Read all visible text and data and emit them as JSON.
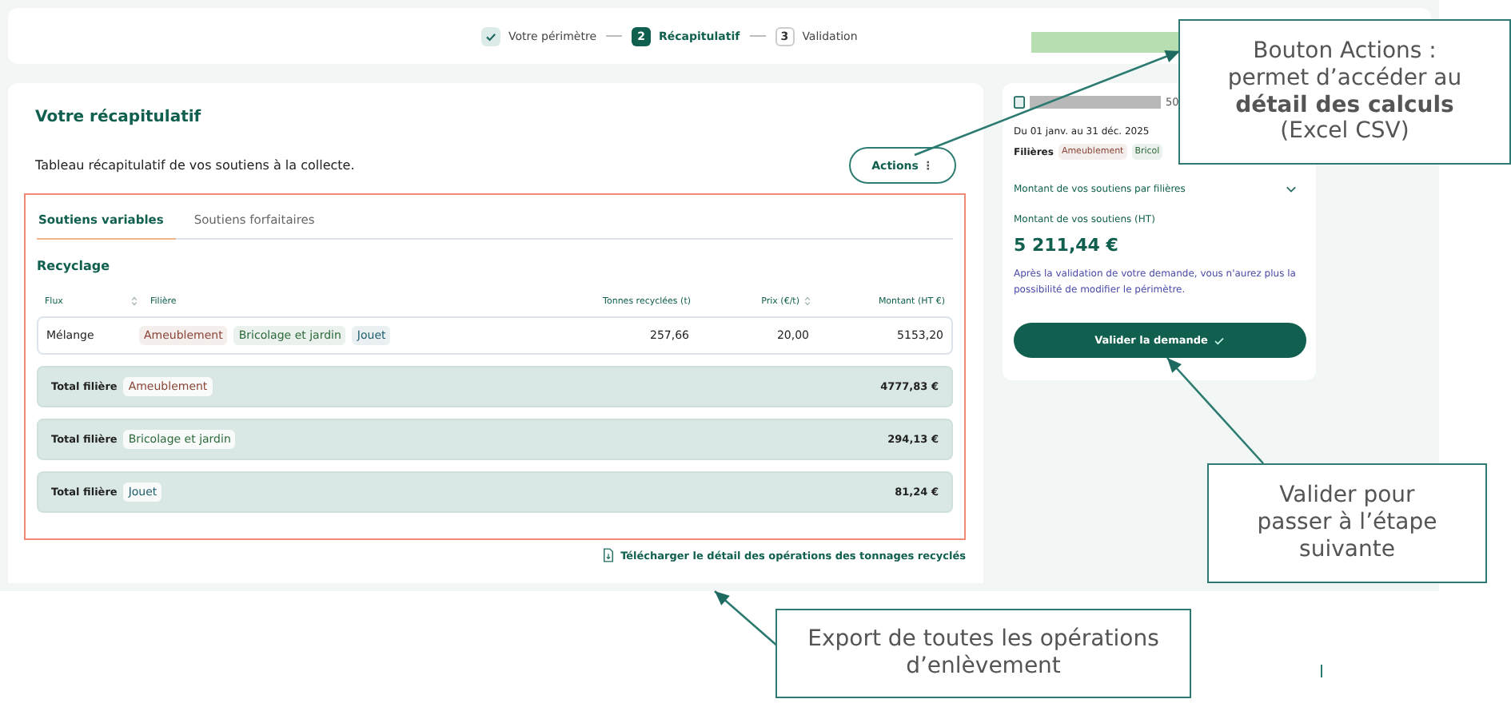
{
  "stepper": {
    "steps": [
      {
        "label": "Votre périmètre",
        "kind": "done"
      },
      {
        "number": "2",
        "label": "Récapitulatif",
        "kind": "current"
      },
      {
        "number": "3",
        "label": "Validation",
        "kind": "upcoming"
      }
    ]
  },
  "summary": {
    "title": "Votre récapitulatif",
    "description": "Tableau récapitulatif de vos soutiens à la collecte.",
    "actions_button": "Actions",
    "actions_icon": "⋮",
    "tabs": [
      {
        "label": "Soutiens variables",
        "selected": true
      },
      {
        "label": "Soutiens forfaitaires",
        "selected": false
      }
    ],
    "section_title": "Recyclage",
    "table": {
      "columns": [
        {
          "label": "Flux",
          "sortable": true
        },
        {
          "label": "Filière",
          "sortable": false
        },
        {
          "label": "Tonnes recyclées (t)",
          "sortable": false
        },
        {
          "label": "Prix (€/t)",
          "sortable": true
        },
        {
          "label": "Montant (HT €)",
          "sortable": false
        }
      ],
      "rows": [
        {
          "flux": "Mélange",
          "filieres": [
            {
              "label": "Ameublement",
              "color": "#8a4638"
            },
            {
              "label": "Bricolage et jardin",
              "color": "#2d6a3b"
            },
            {
              "label": "Jouet",
              "color": "#1c5d6b"
            }
          ],
          "tonnes": "257,66",
          "prix": "20,00",
          "montant": "5153,20"
        }
      ]
    },
    "totals": [
      {
        "label": "Total filière",
        "filiere": {
          "label": "Ameublement",
          "color": "#8a4638"
        },
        "amount": "4777,83 €"
      },
      {
        "label": "Total filière",
        "filiere": {
          "label": "Bricolage et jardin",
          "color": "#2d6a3b"
        },
        "amount": "294,13 €"
      },
      {
        "label": "Total filière",
        "filiere": {
          "label": "Jouet",
          "color": "#1c5d6b"
        },
        "amount": "81,24 €"
      }
    ],
    "download_link": "Télécharger le détail des opérations des tonnages recyclés"
  },
  "side_panel": {
    "id_suffix": "50",
    "period": "Du 01 janv. au 31 déc. 2025",
    "filieres_label": "Filières",
    "filieres": [
      {
        "label": "Ameublement",
        "color": "#8a4638"
      },
      {
        "label": "Bricol",
        "color": "#2d6a3b"
      }
    ],
    "breakdown": {
      "label": "Montant de vos soutiens par filières",
      "expanded": false
    },
    "amount_label": "Montant de vos soutiens (HT)",
    "amount": "5 211,44 €",
    "notice": "Après la validation de votre demande, vous n'aurez plus la possibilité de modifier le périmètre.",
    "validate_button": "Valider la demande"
  },
  "callouts": [
    {
      "text": "Bouton Actions : permet d’accéder au **détail des calculs** (Excel CSV)"
    },
    {
      "text": "Valider pour passer à l’étape suivante"
    },
    {
      "text": "Export de toutes les opérations d’enlèvement"
    }
  ]
}
